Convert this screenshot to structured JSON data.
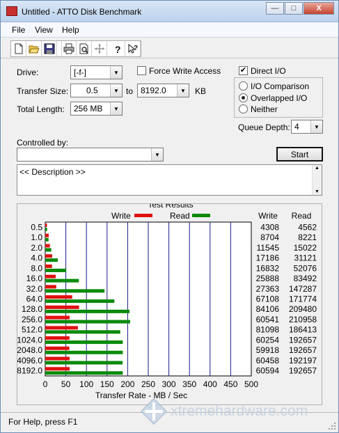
{
  "window": {
    "title": "Untitled - ATTO Disk Benchmark",
    "buttons": {
      "minimize": "—",
      "maximize": "□",
      "close": "X"
    }
  },
  "menu": {
    "file": "File",
    "view": "View",
    "help": "Help"
  },
  "toolbar": {
    "icons": [
      "new-icon",
      "open-icon",
      "save-icon",
      "print-icon",
      "print-preview-icon",
      "move-icon",
      "help-icon",
      "context-help-icon"
    ]
  },
  "settings": {
    "drive_label": "Drive:",
    "drive_value": "[-f-]",
    "force_write_label": "Force Write Access",
    "transfer_size_label": "Transfer Size:",
    "transfer_from": "0.5",
    "to_label": "to",
    "transfer_to": "8192.0",
    "kb_label": "KB",
    "total_length_label": "Total Length:",
    "total_length_value": "256 MB",
    "direct_io_label": "Direct I/O",
    "io_comparison_label": "I/O Comparison",
    "overlapped_io_label": "Overlapped I/O",
    "neither_label": "Neither",
    "queue_depth_label": "Queue Depth:",
    "queue_depth_value": "4",
    "controlled_by_label": "Controlled by:",
    "controlled_by_value": "",
    "start_label": "Start",
    "description": "<< Description >>"
  },
  "results": {
    "group_title": "Test Results",
    "legend_write": "Write",
    "legend_read": "Read",
    "col_write": "Write",
    "col_read": "Read",
    "write_color": "#e01010",
    "read_color": "#0a8a0a"
  },
  "chart_data": {
    "type": "bar",
    "orientation": "horizontal",
    "categories": [
      "0.5",
      "1.0",
      "2.0",
      "4.0",
      "8.0",
      "16.0",
      "32.0",
      "64.0",
      "128.0",
      "256.0",
      "512.0",
      "1024.0",
      "2048.0",
      "4096.0",
      "8192.0"
    ],
    "series": [
      {
        "name": "Write",
        "values": [
          4308,
          8704,
          11545,
          17186,
          16832,
          25888,
          27363,
          67108,
          84106,
          60541,
          81098,
          60254,
          59918,
          60458,
          60594
        ]
      },
      {
        "name": "Read",
        "values": [
          4562,
          8221,
          15022,
          31121,
          52076,
          83492,
          147287,
          171774,
          209480,
          210958,
          186413,
          192657,
          192657,
          192197,
          192657
        ]
      }
    ],
    "xlabel": "Transfer Rate - MB / Sec",
    "xlim": [
      0,
      500
    ],
    "xticks": [
      "0",
      "50",
      "100",
      "150",
      "200",
      "250",
      "300",
      "350",
      "400",
      "450",
      "500"
    ],
    "grid": true,
    "legend": "top"
  },
  "status": {
    "text": "For Help, press F1"
  },
  "watermark": {
    "text": "xtremehardware.com"
  }
}
